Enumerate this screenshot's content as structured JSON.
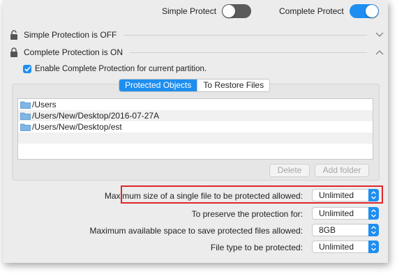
{
  "toolbar": {
    "simple_protect_label": "Simple Protect",
    "simple_protect_state": "off",
    "complete_protect_label": "Complete Protect",
    "complete_protect_state": "on"
  },
  "sections": {
    "simple": {
      "title": "Simple Protection is OFF",
      "icon": "lock-open-icon",
      "chevron": "chevron-down-icon"
    },
    "complete": {
      "title": "Complete Protection is ON",
      "icon": "lock-closed-icon",
      "chevron": "chevron-up-icon"
    }
  },
  "enable_checkbox": {
    "label": "Enable Complete Protection for current partition.",
    "checked": true
  },
  "tabs": [
    {
      "label": "Protected Objects",
      "active": true
    },
    {
      "label": "To Restore Files",
      "active": false
    }
  ],
  "protected_objects": [
    {
      "path": "/Users"
    },
    {
      "path": "/Users/New/Desktop/2016-07-27A"
    },
    {
      "path": "/Users/New/Desktop/est"
    }
  ],
  "buttons": {
    "delete": "Delete",
    "add_folder": "Add folder"
  },
  "settings": [
    {
      "label": "Maximum size of a single file to be protected allowed:",
      "value": "Unlimited",
      "highlighted": true
    },
    {
      "label": "To preserve the protection for:",
      "value": "Unlimited",
      "highlighted": false
    },
    {
      "label": "Maximum available space to save protected files allowed:",
      "value": "8GB",
      "highlighted": false
    },
    {
      "label": "File type to be protected:",
      "value": "Unlimited",
      "highlighted": false
    }
  ],
  "colors": {
    "accent": "#1e8ef0",
    "highlight_border": "#e0262b",
    "toggle_off": "#5a5a5a"
  }
}
